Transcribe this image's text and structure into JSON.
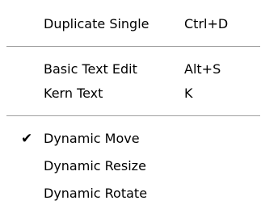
{
  "menu": {
    "items": [
      {
        "label": "Duplicate Single",
        "shortcut": "Ctrl+D",
        "checked": false
      },
      {
        "label": "Basic Text Edit",
        "shortcut": "Alt+S",
        "checked": false
      },
      {
        "label": "Kern Text",
        "shortcut": "K",
        "checked": false
      },
      {
        "label": "Dynamic Move",
        "shortcut": "",
        "checked": true
      },
      {
        "label": "Dynamic Resize",
        "shortcut": "",
        "checked": false
      },
      {
        "label": "Dynamic Rotate",
        "shortcut": "",
        "checked": false
      }
    ],
    "check_glyph": "✔"
  },
  "colors": {
    "background": "#ffffff",
    "text": "#000000",
    "separator": "#a0a0a0"
  }
}
